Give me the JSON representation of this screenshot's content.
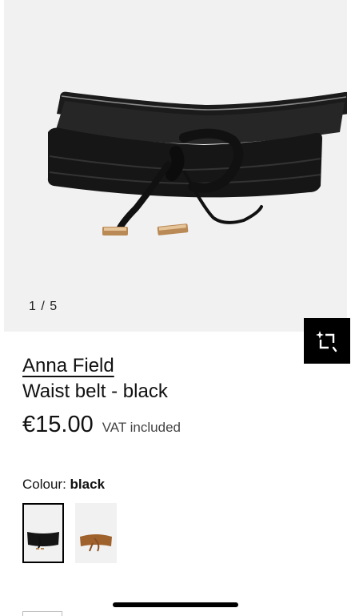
{
  "gallery": {
    "counter": "1 / 5",
    "image_alt": "Black waist belt"
  },
  "product": {
    "brand": "Anna Field",
    "name": "Waist belt - black",
    "price": "€15.00",
    "vat_note": "VAT included"
  },
  "colour": {
    "label": "Colour:",
    "selected": "black",
    "swatches": [
      "black",
      "brown"
    ]
  },
  "colors": {
    "accent": "#000000",
    "gallery_bg": "#f1f1f1",
    "brown_swatch": "#a0622d"
  },
  "icons": {
    "try_on": "sparkle-crop-icon"
  }
}
